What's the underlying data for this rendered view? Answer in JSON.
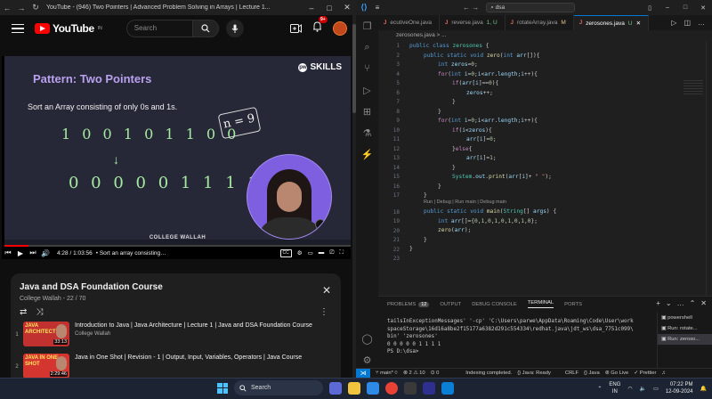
{
  "youtube": {
    "window_title": "YouTube - (946) Two Pointers | Advanced Problem Solving in Arrays | Lecture 1...",
    "logo_text": "YouTube",
    "logo_region": "IN",
    "search_placeholder": "Search",
    "notification_count": "9+",
    "video": {
      "slide_title": "Pattern: Two Pointers",
      "brand": "SKILLS",
      "subtitle": "Sort an Array consisting of only 0s and 1s.",
      "input_digits": "1 0 0 1 0 1 1 0 0",
      "output_digits": "0 0 0 0 0 1 1 1 1",
      "arrow": "↓",
      "n_label": "n = 9",
      "watermark": "COLLEGE WALLAH",
      "time": "4:28 / 1:03:56",
      "chapter": "• Sort an array consisting of ...",
      "progress": 0.07
    },
    "playlist": {
      "title": "Java and DSA Foundation Course",
      "subtitle": "College Wallah - 22 / 70",
      "items": [
        {
          "index": "1",
          "thumb_text": "JAVA ARCHITECTURE",
          "duration": "33:13",
          "title": "Introduction to Java | Java Architecture | Lecture 1 | Java and DSA Foundation Course",
          "channel": "College Wallah"
        },
        {
          "index": "2",
          "thumb_text": "JAVA IN ONE SHOT",
          "duration": "2:29:46",
          "title": "Java in One Shot | Revision - 1 | Output, Input, Variables, Operators | Java Course",
          "channel": ""
        }
      ]
    }
  },
  "vscode": {
    "search_text": "dsa",
    "tabs": [
      {
        "label": "ecutiveOne.java",
        "status": "",
        "active": false
      },
      {
        "label": "reverse.java",
        "status": "1, U",
        "active": false
      },
      {
        "label": "rotateArray.java",
        "status": "M",
        "active": false
      },
      {
        "label": "zerosones.java",
        "status": "U",
        "active": true
      }
    ],
    "breadcrumb": "zerosones.java > ...",
    "line_numbers": [
      "1",
      "2",
      "3",
      "4",
      "5",
      "6",
      "7",
      "8",
      "9",
      "10",
      "11",
      "12",
      "13",
      "14",
      "15",
      "16",
      "17",
      "18",
      "19",
      "20",
      "21",
      "22",
      "23"
    ],
    "code_lens": "Run | Debug | Run main | Debug main",
    "panel_tabs": {
      "problems": "PROBLEMS",
      "problems_count": "12",
      "output": "OUTPUT",
      "debug": "DEBUG CONSOLE",
      "terminal": "TERMINAL",
      "ports": "PORTS"
    },
    "terminal_lines": [
      "tailsInExceptionMessages' '-cp' 'C:\\Users\\parwe\\AppData\\Roaming\\Code\\User\\work",
      "spaceStorage\\16d16a8be2f15177a6382d291c554334\\redhat.java\\jdt_ws\\dsa_7751c099\\",
      "bin' 'zerosones'",
      "0 0 0 0 0 1 1 1 1",
      "PS D:\\dsa>"
    ],
    "terminal_list": [
      "powershell",
      "Run: rotate...",
      "Run: zeroso..."
    ],
    "status": {
      "branch": "main*",
      "errors": "2",
      "warnings": "10",
      "ports": "0",
      "indexing": "Indexing completed.",
      "java": "Java: Ready",
      "eol": "CRLF",
      "lang": "Java",
      "golive": "Go Live",
      "prettier": "Prettier"
    }
  },
  "taskbar": {
    "search": "Search",
    "lang1": "ENG",
    "lang2": "IN",
    "time": "07:22 PM",
    "date": "12-09-2024"
  }
}
